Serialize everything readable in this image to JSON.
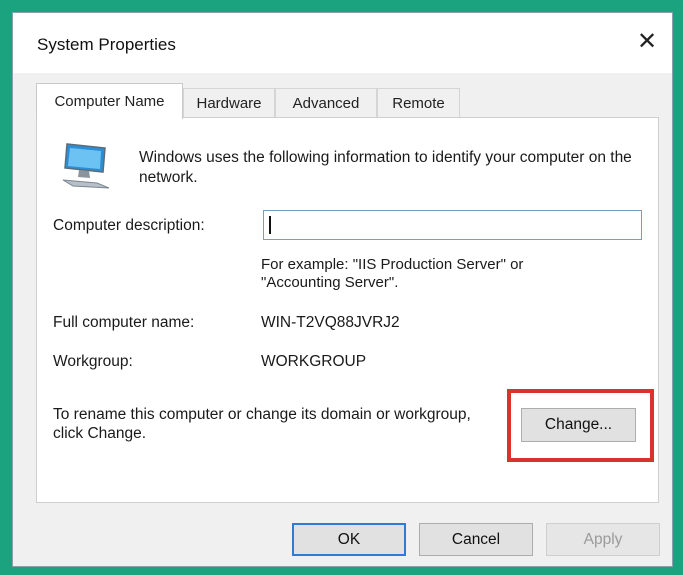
{
  "window": {
    "title": "System Properties",
    "close_glyph": "✕"
  },
  "tabs": [
    {
      "label": "Computer Name",
      "active": true
    },
    {
      "label": "Hardware",
      "active": false
    },
    {
      "label": "Advanced",
      "active": false
    },
    {
      "label": "Remote",
      "active": false
    }
  ],
  "panel": {
    "intro_text": "Windows uses the following information to identify your computer on the network.",
    "description_label": "Computer description:",
    "description_value": "",
    "example_text": "For example: \"IIS Production Server\" or \"Accounting Server\".",
    "full_name_label": "Full computer name:",
    "full_name_value": "WIN-T2VQ88JVRJ2",
    "workgroup_label": "Workgroup:",
    "workgroup_value": "WORKGROUP",
    "rename_text": "To rename this computer or change its domain or workgroup, click Change.",
    "change_button": "Change..."
  },
  "footer": {
    "ok": "OK",
    "cancel": "Cancel",
    "apply": "Apply"
  },
  "icons": {
    "computer": "computer-icon",
    "close": "close-icon"
  },
  "colors": {
    "background": "#1aa37e",
    "highlight": "#d9322f",
    "focus": "#2f7bd6"
  }
}
